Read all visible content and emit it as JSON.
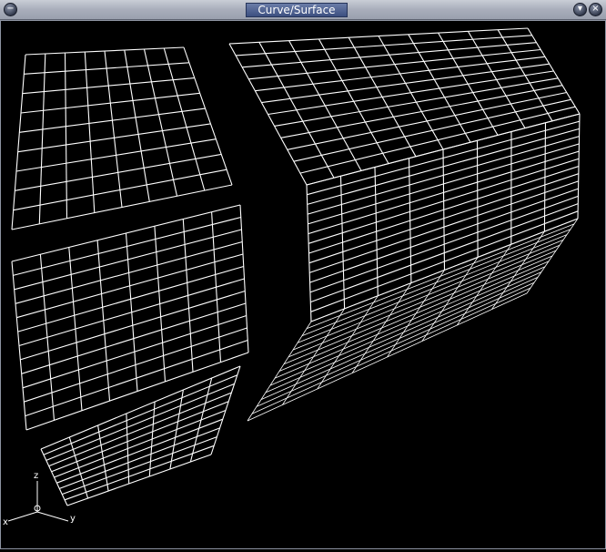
{
  "window": {
    "title": "Curve/Surface",
    "left_button_icon": "minimize-icon",
    "right_buttons": [
      "shade-icon",
      "close-icon"
    ]
  },
  "viewport": {
    "background": "#000000",
    "wire_color": "#ffffff",
    "axes": {
      "z_label": "z",
      "y_label": "y",
      "x_label": "x"
    },
    "surfaces": [
      {
        "name": "upper-left-patch",
        "rows": 9,
        "cols": 8
      },
      {
        "name": "middle-left-patch",
        "rows": 12,
        "cols": 8
      },
      {
        "name": "lower-left-patch",
        "rows": 10,
        "cols": 7
      },
      {
        "name": "top-right-patch",
        "rows": 12,
        "cols": 10
      },
      {
        "name": "front-right-patch",
        "rows": 14,
        "cols": 8
      },
      {
        "name": "bottom-right-patch",
        "rows": 14,
        "cols": 8
      }
    ]
  }
}
